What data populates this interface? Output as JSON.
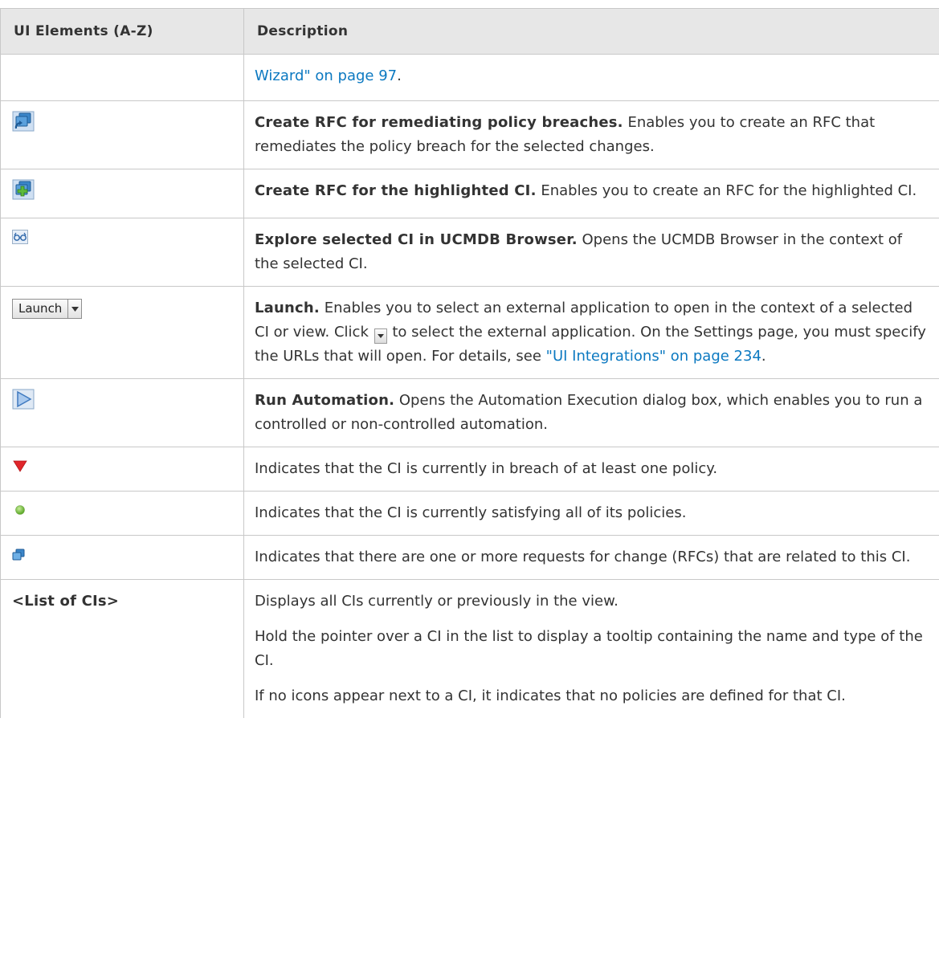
{
  "header": {
    "col1": "UI Elements (A-Z)",
    "col2": "Description"
  },
  "row0": {
    "link": "Wizard\" on page 97",
    "after": "."
  },
  "row1": {
    "icon": "rfc-remediate-icon",
    "title": "Create RFC for remediating policy breaches.",
    "text": " Enables you to create an RFC that remediates the policy breach for the selected changes."
  },
  "row2": {
    "icon": "rfc-create-plus-icon",
    "title": "Create RFC for the highlighted CI.",
    "text": " Enables you to create an RFC for the highlighted CI."
  },
  "row3": {
    "icon": "explore-glasses-icon",
    "title": "Explore selected CI in UCMDB Browser.",
    "text": " Opens the UCMDB Browser in the context of the selected CI."
  },
  "row4": {
    "launch_label": "Launch",
    "title": "Launch.",
    "text1": " Enables you to select an external application to open in the context of a selected CI or view. Click ",
    "text2": " to select the external application. On the Settings page, you must specify the URLs that will open. For details, see ",
    "link": "\"UI Integrations\" on page 234",
    "after": "."
  },
  "row5": {
    "icon": "run-automation-icon",
    "title": "Run Automation.",
    "text": " Opens the Automation Execution dialog box, which enables you to run a controlled or non-controlled automation."
  },
  "row6": {
    "icon": "breach-triangle-icon",
    "text": "Indicates that the CI is currently in breach of at least one policy."
  },
  "row7": {
    "icon": "satisfied-circle-icon",
    "text": "Indicates that the CI is currently satisfying all of its policies."
  },
  "row8": {
    "icon": "rfc-related-icon",
    "text": "Indicates that there are one or more requests for change (RFCs) that are related to this CI."
  },
  "row9": {
    "element": "<List of CIs>",
    "p1": "Displays all CIs currently or previously in the view.",
    "p2": "Hold the pointer over a CI in the list to display a tooltip containing the name and type of the CI.",
    "p3": "If no icons appear next to a CI, it indicates that no policies are defined for that CI."
  }
}
